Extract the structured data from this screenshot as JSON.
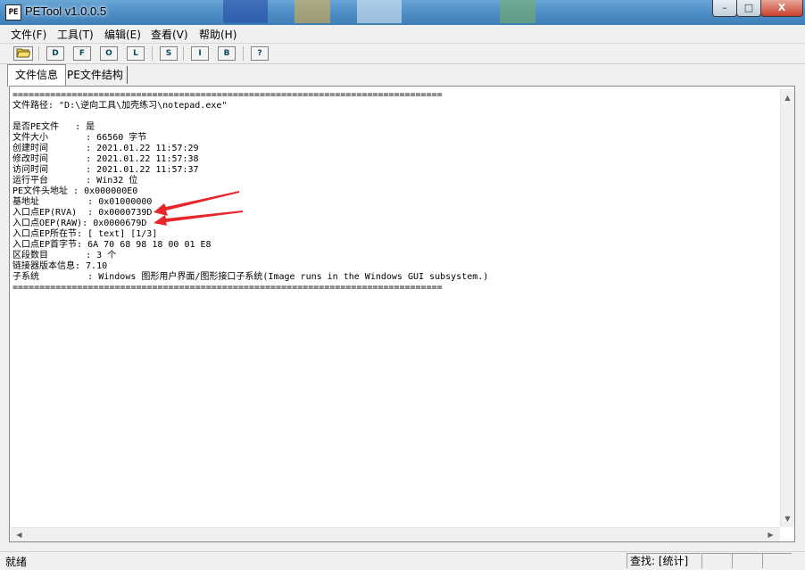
{
  "window": {
    "icon_text": "PE",
    "title": "PETool v1.0.0.5",
    "minimize_label": "–",
    "maximize_label": "□",
    "close_label": "X"
  },
  "menu": {
    "items": [
      "文件(F)",
      "工具(T)",
      "编辑(E)",
      "查看(V)",
      "帮助(H)"
    ]
  },
  "toolbar": {
    "buttons": [
      "D",
      "F",
      "O",
      "L",
      "S",
      "I",
      "B",
      "?"
    ]
  },
  "tabs": [
    {
      "label": "文件信息",
      "active": true
    },
    {
      "label": "PE文件结构",
      "active": false
    }
  ],
  "content": {
    "lines": [
      "================================================================================",
      "文件路径: \"D:\\逆向工具\\加壳练习\\notepad.exe\"",
      "",
      "是否PE文件   : 是",
      "文件大小       : 66560 字节",
      "创建时间       : 2021.01.22 11:57:29",
      "修改时间       : 2021.01.22 11:57:38",
      "访问时间       : 2021.01.22 11:57:37",
      "运行平台       : Win32 位",
      "PE文件头地址 : 0x000000E0",
      "基地址         : 0x01000000",
      "入口点EP(RVA)  : 0x0000739D",
      "入口点OEP(RAW): 0x0000679D",
      "入口点EP所在节: [ text] [1/3]",
      "入口点EP首字节: 6A 70 68 98 18 00 01 E8",
      "区段数目       : 3 个",
      "链接器版本信息: 7.10",
      "子系统         : Windows 图形用户界面/图形接口子系统(Image runs in the Windows GUI subsystem.)",
      "================================================================================"
    ]
  },
  "scroll": {
    "up": "▲",
    "down": "▼",
    "left": "◀",
    "right": "▶"
  },
  "status": {
    "left": "就绪",
    "find": "查找: [统计]"
  },
  "colors": {
    "arrow": "#e8262a",
    "titlebar": "#4f90c8",
    "toolbar_text": "#0a4a5e"
  }
}
